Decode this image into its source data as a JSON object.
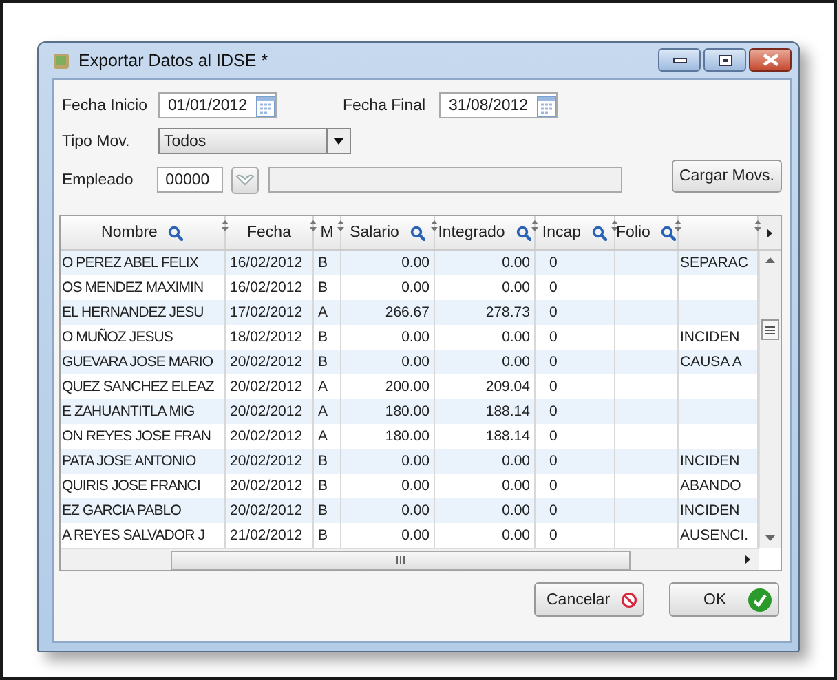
{
  "window": {
    "title": "Exportar Datos al IDSE *"
  },
  "form": {
    "fecha_inicio": {
      "label": "Fecha Inicio",
      "value": "01/01/2012"
    },
    "fecha_final": {
      "label": "Fecha Final",
      "value": "31/08/2012"
    },
    "tipo_mov": {
      "label": "Tipo Mov.",
      "value": "Todos"
    },
    "empleado": {
      "label": "Empleado",
      "value": "00000"
    },
    "load_button": "Cargar Movs."
  },
  "table": {
    "columns": [
      {
        "label": "Nombre",
        "searchable": true
      },
      {
        "label": "Fecha",
        "searchable": false
      },
      {
        "label": "M",
        "searchable": false
      },
      {
        "label": "Salario",
        "searchable": true
      },
      {
        "label": "Integrado",
        "searchable": true
      },
      {
        "label": "Incap",
        "searchable": true
      },
      {
        "label": "Folio",
        "searchable": true
      },
      {
        "searchable": false
      }
    ],
    "rows": [
      {
        "nombre": "O PEREZ ABEL FELIX",
        "fecha": "16/02/2012",
        "m": "B",
        "salario": "0.00",
        "integrado": "0.00",
        "incap": "0",
        "column_8": "SEPARAC"
      },
      {
        "nombre": "OS MENDEZ MAXIMIN",
        "fecha": "16/02/2012",
        "m": "B",
        "salario": "0.00",
        "integrado": "0.00",
        "incap": "0"
      },
      {
        "nombre": "EL HERNANDEZ JESU",
        "fecha": "17/02/2012",
        "m": "A",
        "salario": "266.67",
        "integrado": "278.73",
        "incap": "0"
      },
      {
        "nombre": "O MUÑOZ JESUS",
        "fecha": "18/02/2012",
        "m": "B",
        "salario": "0.00",
        "integrado": "0.00",
        "incap": "0",
        "column_8": "INCIDEN"
      },
      {
        "nombre": "GUEVARA JOSE MARIO",
        "fecha": "20/02/2012",
        "m": "B",
        "salario": "0.00",
        "integrado": "0.00",
        "incap": "0",
        "column_8": "CAUSA A"
      },
      {
        "nombre": "QUEZ SANCHEZ ELEAZ",
        "fecha": "20/02/2012",
        "m": "A",
        "salario": "200.00",
        "integrado": "209.04",
        "incap": "0"
      },
      {
        "nombre": "E ZAHUANTITLA MIG",
        "fecha": "20/02/2012",
        "m": "A",
        "salario": "180.00",
        "integrado": "188.14",
        "incap": "0"
      },
      {
        "nombre": "ON REYES JOSE FRAN",
        "fecha": "20/02/2012",
        "m": "A",
        "salario": "180.00",
        "integrado": "188.14",
        "incap": "0"
      },
      {
        "nombre": "PATA JOSE ANTONIO",
        "fecha": "20/02/2012",
        "m": "B",
        "salario": "0.00",
        "integrado": "0.00",
        "incap": "0",
        "column_8": "INCIDEN"
      },
      {
        "nombre": "QUIRIS JOSE FRANCI",
        "fecha": "20/02/2012",
        "m": "B",
        "salario": "0.00",
        "integrado": "0.00",
        "incap": "0",
        "column_8": "ABANDO"
      },
      {
        "nombre": "EZ GARCIA PABLO",
        "fecha": "20/02/2012",
        "m": "B",
        "salario": "0.00",
        "integrado": "0.00",
        "incap": "0",
        "column_8": "INCIDEN"
      },
      {
        "nombre": "A REYES SALVADOR J",
        "fecha": "21/02/2012",
        "m": "B",
        "salario": "0.00",
        "integrado": "0.00",
        "incap": "0",
        "column_8": "AUSENCI."
      }
    ]
  },
  "buttons": [
    {
      "label": "Cancelar",
      "kind": "cancel"
    },
    {
      "label": "OK",
      "kind": "ok"
    }
  ]
}
